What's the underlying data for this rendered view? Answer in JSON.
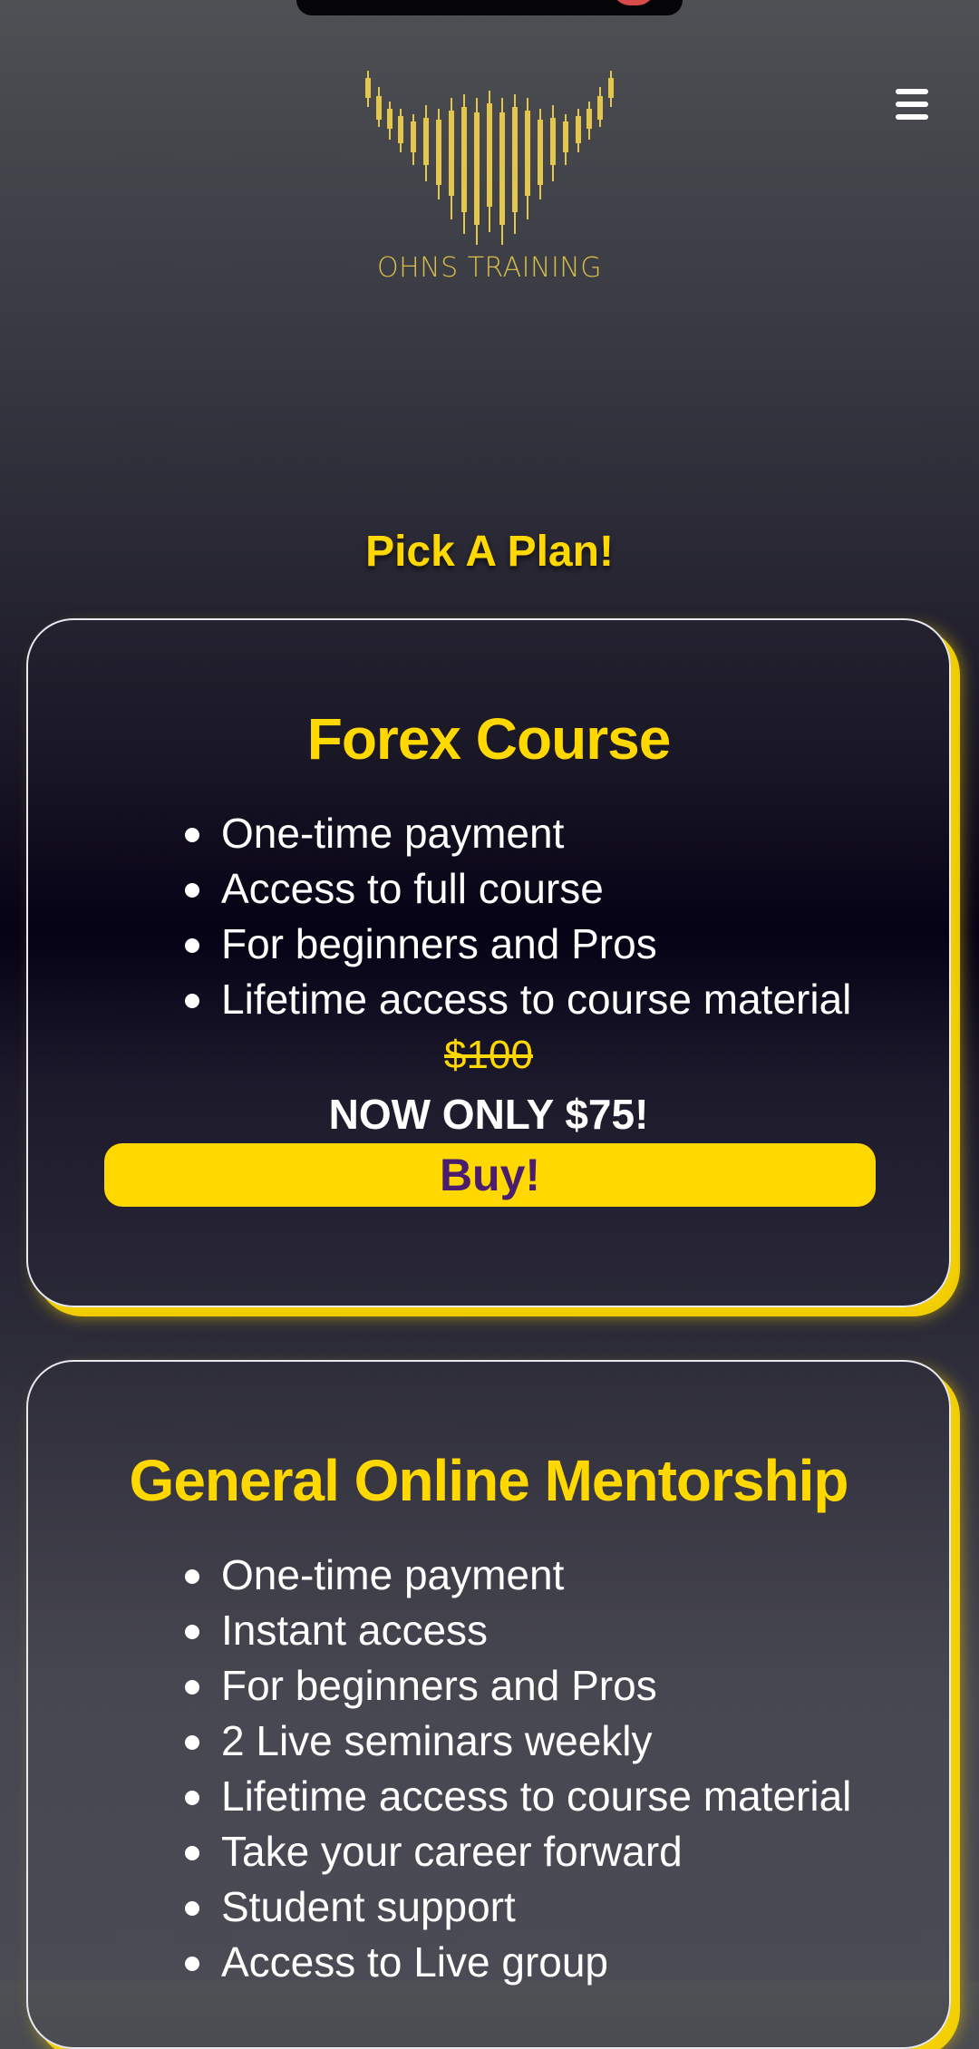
{
  "header": {
    "logo_text": "OHNS TRAINING",
    "menu_icon": "hamburger-icon"
  },
  "main": {
    "heading": "Pick A Plan!",
    "plans": [
      {
        "title": "Forex Course",
        "features": [
          "One-time payment",
          "Access to full course",
          "For beginners and Pros",
          "Lifetime access to course material"
        ],
        "old_price": "$100",
        "promo_price": "NOW ONLY $75!",
        "cta_label": "Buy!"
      },
      {
        "title": "General Online Mentorship",
        "features": [
          "One-time payment",
          "Instant access",
          "For beginners and Pros",
          "2 Live seminars weekly",
          "Lifetime access to course material",
          "Take your career forward",
          "Student support",
          "Access to Live group"
        ]
      }
    ]
  },
  "colors": {
    "accent": "#FFD800",
    "button_text": "#4A1D6F",
    "card_border": "#E9E9F1"
  }
}
